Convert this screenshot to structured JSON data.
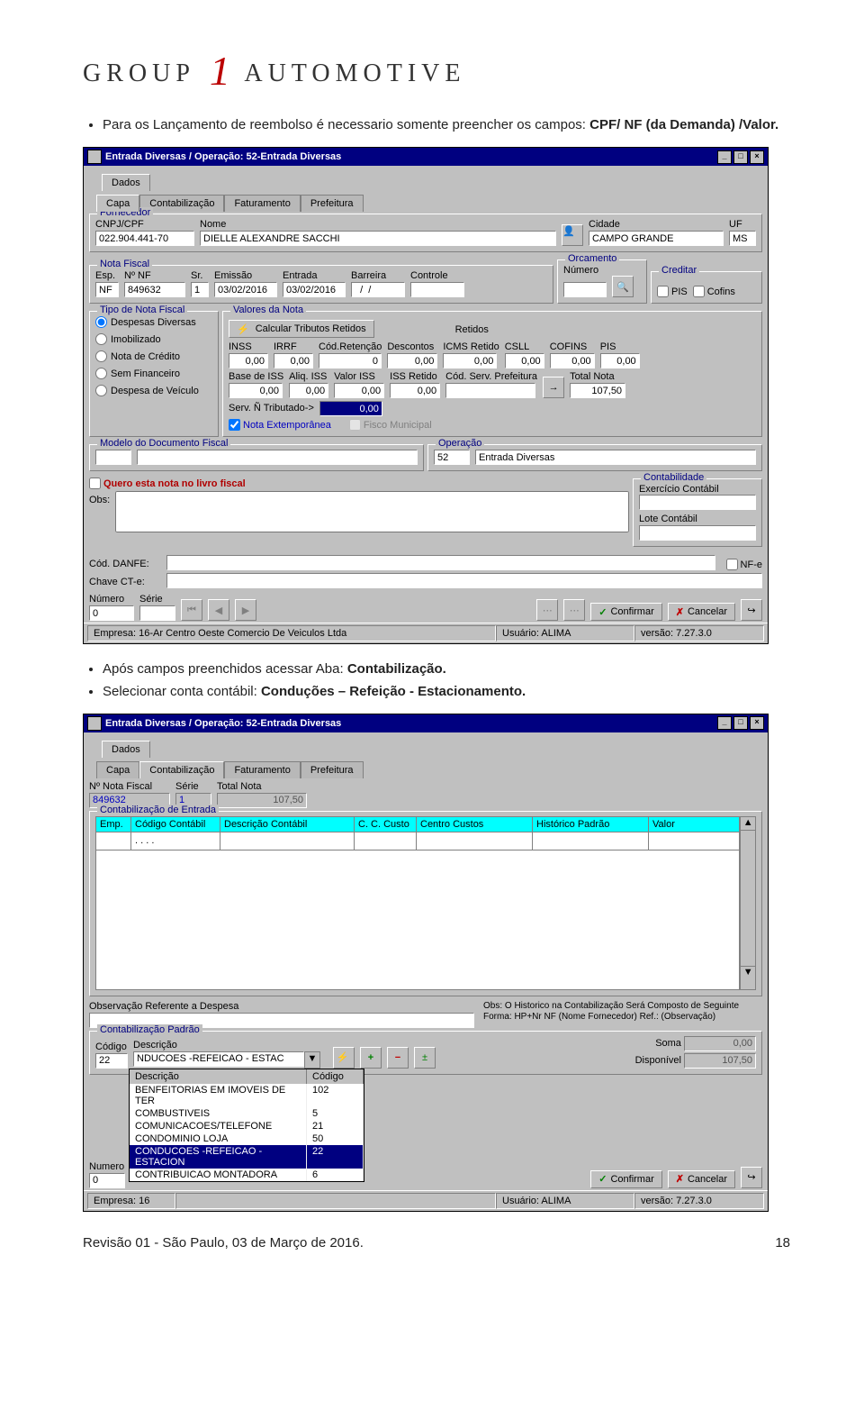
{
  "doc": {
    "logo": {
      "left": "GROUP",
      "one": "1",
      "right": "AUTOMOTIVE"
    },
    "bullet1": "Para os Lançamento de reembolso é  necessario somente preencher os campos: ",
    "bullet1_bold": "CPF/ NF (da Demanda) /Valor.",
    "bullet2a": "Após campos preenchidos acessar Aba: ",
    "bullet2a_bold": "Contabilização.",
    "bullet2b": "Selecionar conta contábil: ",
    "bullet2b_bold": "Conduções – Refeição - Estacionamento.",
    "footer": "Revisão 01 - São Paulo, 03 de Março de 2016.",
    "page_number": "18"
  },
  "win": {
    "title": "Entrada Diversas / Operação: 52-Entrada Diversas",
    "dados": "Dados"
  },
  "tabs": {
    "capa": "Capa",
    "contab": "Contabilização",
    "fatur": "Faturamento",
    "pref": "Prefeitura"
  },
  "s1": {
    "forn_legend": "Fornecedor",
    "cnpj_label": "CNPJ/CPF",
    "cnpj": "022.904.441-70",
    "nome_label": "Nome",
    "nome": "DIELLE ALEXANDRE SACCHI",
    "cidade_label": "Cidade",
    "cidade": "CAMPO GRANDE",
    "uf_label": "UF",
    "uf": "MS",
    "nf_legend": "Nota Fiscal",
    "esp_label": "Esp.",
    "esp": "NF",
    "nrnf_label": "Nº NF",
    "nrnf": "849632",
    "sr_label": "Sr.",
    "sr": "1",
    "emissao_label": "Emissão",
    "emissao": "03/02/2016",
    "entrada_label": "Entrada",
    "entrada": "03/02/2016",
    "barreira_label": "Barreira",
    "barreira": "  /  /",
    "controle_label": "Controle",
    "controle": "",
    "orc_legend": "Orcamento",
    "orc_num_label": "Número",
    "cred_legend": "Creditar",
    "pis": "PIS",
    "cofins": "Cofins",
    "tipo_legend": "Tipo de Nota Fiscal",
    "r_desp": "Despesas Diversas",
    "r_imob": "Imobilizado",
    "r_ncred": "Nota de Crédito",
    "r_sfin": "Sem Financeiro",
    "r_dveic": "Despesa de Veículo",
    "val_legend": "Valores da Nota",
    "calc_btn": "Calcular Tributos Retidos",
    "retidos_legend": "Retidos",
    "inss_l": "INSS",
    "irrf_l": "IRRF",
    "codret_l": "Cód.Retenção",
    "desc_l": "Descontos",
    "icms_l": "ICMS Retido",
    "csll_l": "CSLL",
    "cofret_l": "COFINS",
    "pisret_l": "PIS",
    "inss": "0,00",
    "irrf": "0,00",
    "codret": "0",
    "desc": "0,00",
    "icms": "0,00",
    "csll": "0,00",
    "cofret": "0,00",
    "pisret": "0,00",
    "biss_l": "Base de ISS",
    "aliq_l": "Aliq. ISS",
    "viss_l": "Valor ISS",
    "issret_l": "ISS Retido",
    "codserv_l": "Cód. Serv. Prefeitura",
    "total_l": "Total Nota",
    "biss": "0,00",
    "aliq": "0,00",
    "viss": "0,00",
    "issret": "0,00",
    "total": "107,50",
    "serv_nt_l": "Serv. Ñ Tributado->",
    "serv_nt": "0,00",
    "notaext": "Nota Extemporânea",
    "fiscomun": "Fisco Municipal",
    "modelo_legend": "Modelo do Documento Fiscal",
    "oper_legend": "Operação",
    "oper_cod": "52",
    "oper_desc": "Entrada Diversas",
    "quero": "Quero esta nota no livro fiscal",
    "obs_label": "Obs:",
    "contab_legend": "Contabilidade",
    "exerc_l": "Exercício Contábil",
    "lote_l": "Lote Contábil",
    "danfe_l": "Cód. DANFE:",
    "nfe_chk": "NF-e",
    "cte_l": "Chave CT-e:",
    "num_l": "Número",
    "num_v": "0",
    "serie_l": "Série",
    "confirm": "Confirmar",
    "cancel": "Cancelar",
    "sb_empresa": "Empresa: 16-Ar Centro Oeste Comercio De Veiculos Ltda",
    "sb_user": "Usuário: ALIMA",
    "sb_ver": "versão: 7.27.3.0"
  },
  "s2": {
    "nrnf_label": "Nº Nota Fiscal",
    "nrnf": "849632",
    "serie_label": "Série",
    "serie": "1",
    "total_label": "Total Nota",
    "total": "107,50",
    "centrada_legend": "Contabilização de Entrada",
    "th_emp": "Emp.",
    "th_cod": "Código Contábil",
    "th_desc": "Descrição Contábil",
    "th_ccc": "C. C. Custo",
    "th_centro": "Centro Custos",
    "th_hist": "Histórico Padrão",
    "th_valor": "Valor",
    "row_dots": ". . . .",
    "obsdesp_l": "Observação Referente a Despesa",
    "obshist": "Obs: O Historico na Contabilização Será Composto de Seguinte Forma: HP+Nr NF (Nome Fornecedor) Ref.: (Observação)",
    "cpadrao_legend": "Contabilização Padrão",
    "cpad_cod_l": "Código",
    "cpad_desc_l": "Descrição",
    "cpad_cod": "22",
    "cpad_desc": "NDUCOES -REFEICAO - ESTAC",
    "soma_l": "Soma",
    "soma_v": "0,00",
    "disp_l": "Disponível",
    "disp_v": "107,50",
    "dd_desc": "Descrição",
    "dd_cod": "Código",
    "dd": [
      {
        "d": "BENFEITORIAS EM IMOVEIS DE TER",
        "c": "102"
      },
      {
        "d": "COMBUSTIVEIS",
        "c": "5"
      },
      {
        "d": "COMUNICACOES/TELEFONE",
        "c": "21"
      },
      {
        "d": "CONDOMINIO LOJA",
        "c": "50"
      },
      {
        "d": "CONDUCOES -REFEICAO - ESTACION",
        "c": "22"
      },
      {
        "d": "CONTRIBUICAO MONTADORA",
        "c": "6"
      }
    ],
    "numero_l": "Numero",
    "numero_v": "0",
    "emp16": "Empresa: 16"
  }
}
